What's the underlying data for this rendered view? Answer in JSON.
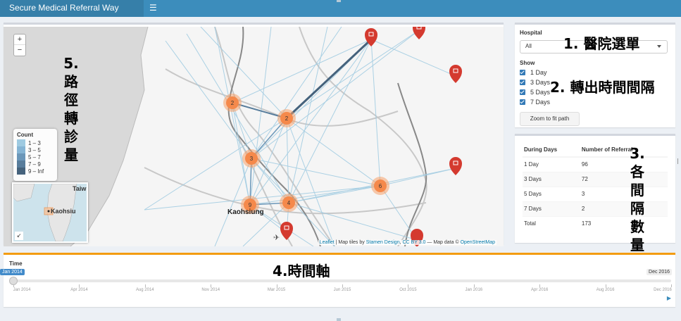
{
  "header": {
    "title": "Secure Medical Referral Way",
    "menu_icon": "hamburger-icon"
  },
  "filters": {
    "hospital_label": "Hospital",
    "hospital_value": "All",
    "show_label": "Show",
    "options": [
      {
        "label": "1 Day",
        "checked": true
      },
      {
        "label": "3 Days",
        "checked": true
      },
      {
        "label": "5 Days",
        "checked": true
      },
      {
        "label": "7 Days",
        "checked": true
      }
    ],
    "zoom_button": "Zoom to fit path"
  },
  "summary_table": {
    "headers": [
      "During Days",
      "Number of Referral"
    ],
    "rows": [
      {
        "days": "1 Day",
        "count": "96"
      },
      {
        "days": "3 Days",
        "count": "72"
      },
      {
        "days": "5 Days",
        "count": "3"
      },
      {
        "days": "7 Days",
        "count": "2"
      },
      {
        "days": "Total",
        "count": "173"
      }
    ]
  },
  "map": {
    "zoom_in": "+",
    "zoom_out": "−",
    "legend_title": "Count",
    "legend": [
      {
        "label": "1 – 3",
        "color": "#9ecae1"
      },
      {
        "label": "3 – 5",
        "color": "#85b4d4"
      },
      {
        "label": "5 – 7",
        "color": "#6b97b9"
      },
      {
        "label": "7 – 9",
        "color": "#587d9c"
      },
      {
        "label": "9 – Inf",
        "color": "#45627c"
      }
    ],
    "city_label": "Kaohsiung",
    "minimap_labels": {
      "country": "Taiw",
      "city": "Kaohsiu"
    },
    "clusters": [
      "2",
      "2",
      "3",
      "6",
      "4",
      "9"
    ],
    "attribution": {
      "leaflet": "Leaflet",
      "tiles_prefix": "| Map tiles by",
      "stamen": "Stamen Design",
      "license": "CC BY 3.0",
      "data_prefix": "— Map data ©",
      "osm": "OpenStreetMap"
    }
  },
  "timeline": {
    "label": "Time",
    "start_badge": "Jan 2014",
    "end_badge": "Dec 2016",
    "ticks": [
      "Jan 2014",
      "Apr 2014",
      "Aug 2014",
      "Nov 2014",
      "Mar 2015",
      "Jun 2015",
      "Oct 2015",
      "Jan 2016",
      "Apr 2016",
      "Aug 2016",
      "Dec 2016"
    ],
    "position": 0
  },
  "annotations": {
    "a1": "1. 醫院選單",
    "a2": "2. 轉出時間間隔",
    "a3_num": "3.",
    "a3_chars": [
      "各",
      "間",
      "隔",
      "數",
      "量"
    ],
    "a4": "4.時間軸",
    "a5_num": "5.",
    "a5_chars": [
      "路",
      "徑",
      "轉",
      "診",
      "量"
    ]
  },
  "colors": {
    "header": "#3c8dbc",
    "brand": "#367fa9",
    "marker": "#d43a2f",
    "cluster": "#f6a06a"
  }
}
